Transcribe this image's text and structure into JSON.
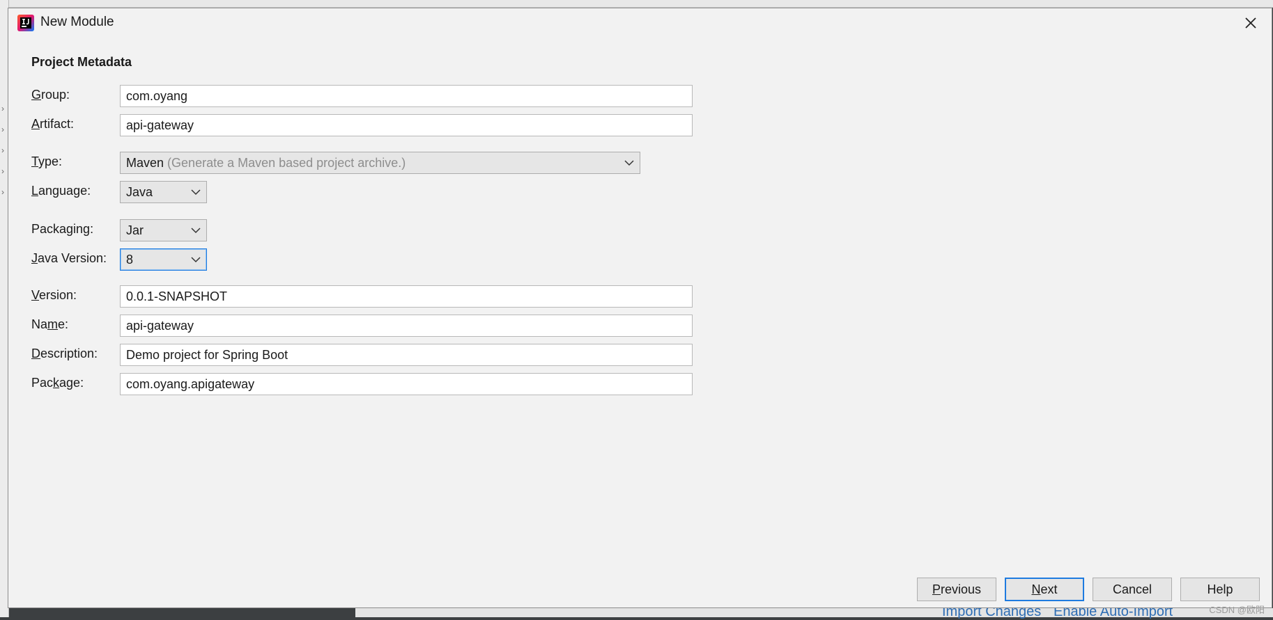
{
  "dialog": {
    "title": "New Module",
    "section_title": "Project Metadata"
  },
  "fields": {
    "group": {
      "label_u": "G",
      "label_rest": "roup:",
      "value": "com.oyang"
    },
    "artifact": {
      "label_u": "A",
      "label_rest": "rtifact:",
      "value": "api-gateway"
    },
    "type": {
      "label_u": "T",
      "label_rest": "ype:",
      "value": "Maven",
      "hint": "(Generate a Maven based project archive.)"
    },
    "language": {
      "label_u": "L",
      "label_rest": "anguage:",
      "value": "Java"
    },
    "packaging": {
      "label_pre": "Packa",
      "label_u": "g",
      "label_rest": "ing:",
      "value": "Jar"
    },
    "java_version": {
      "label_u": "J",
      "label_rest": "ava Version:",
      "value": "8"
    },
    "version": {
      "label_u": "V",
      "label_rest": "ersion:",
      "value": "0.0.1-SNAPSHOT"
    },
    "name": {
      "label_pre": "Na",
      "label_u": "m",
      "label_rest": "e:",
      "value": "api-gateway"
    },
    "description": {
      "label_u": "D",
      "label_rest": "escription:",
      "value": "Demo project for Spring Boot"
    },
    "package": {
      "label_pre": "Pac",
      "label_u": "k",
      "label_rest": "age:",
      "value": "com.oyang.apigateway"
    }
  },
  "buttons": {
    "previous": {
      "u": "P",
      "rest": "revious"
    },
    "next": {
      "u": "N",
      "rest": "ext"
    },
    "cancel": "Cancel",
    "help": "Help"
  },
  "background": {
    "import_changes": "Import Changes",
    "enable_auto_import": "Enable Auto-Import",
    "watermark": "CSDN @欧阳"
  },
  "colors": {
    "accent": "#1e7be0",
    "dialog_bg": "#f2f2f2",
    "hint": "#8d8d8d"
  }
}
